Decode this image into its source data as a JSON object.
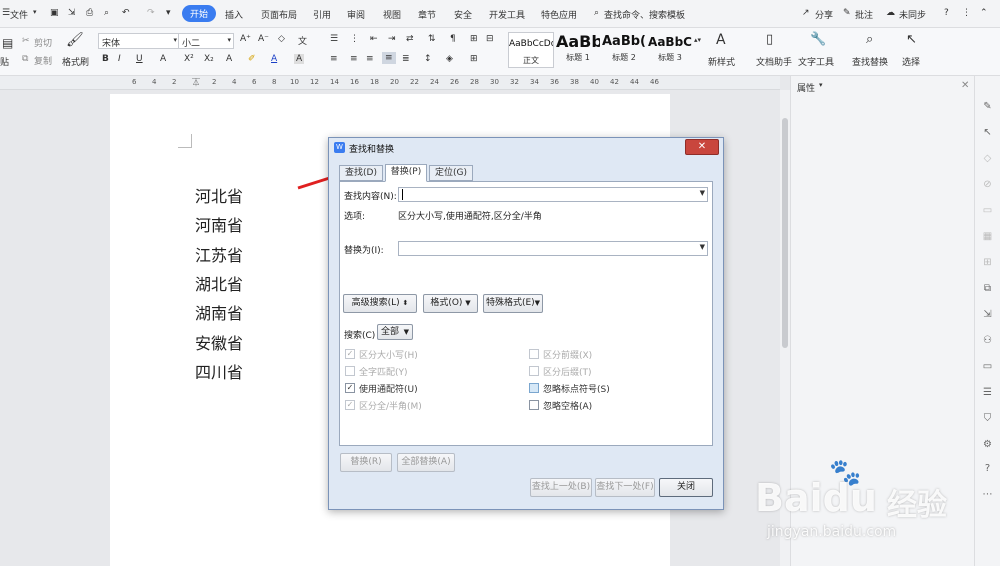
{
  "menubar": {
    "file": "文件",
    "tabs": [
      "开始",
      "插入",
      "页面布局",
      "引用",
      "审阅",
      "视图",
      "章节",
      "安全",
      "开发工具",
      "特色应用"
    ],
    "search": "查找命令、搜索模板",
    "share": "分享",
    "annotate": "批注",
    "sync": "未同步",
    "help": "?"
  },
  "ribbon": {
    "cut": "剪切",
    "copy": "复制",
    "paste": "贴",
    "format_painter": "格式刷",
    "font_name": "宋体",
    "font_size": "小二",
    "styles": [
      {
        "preview": "AaBbCcDd",
        "caption": "正文"
      },
      {
        "preview": "AaBb",
        "caption": "标题 1"
      },
      {
        "preview": "AaBb(",
        "caption": "标题 2"
      },
      {
        "preview": "AaBbC",
        "caption": "标题 3"
      }
    ],
    "new_style": "新样式",
    "doc_assistant": "文档助手",
    "text_tools": "文字工具",
    "find_replace": "查找替换",
    "select": "选择"
  },
  "ruler": {
    "ticks": [
      "6",
      "4",
      "2",
      "2",
      "4",
      "6",
      "8",
      "10",
      "12",
      "14",
      "16",
      "18",
      "20",
      "22",
      "24",
      "26",
      "28",
      "30",
      "32",
      "34",
      "36",
      "38",
      "40",
      "42",
      "44",
      "46"
    ]
  },
  "properties_panel": {
    "title": "属性"
  },
  "document": {
    "lines": [
      "河北省",
      "河南省",
      "江苏省",
      "湖北省",
      "湖南省",
      "安徽省",
      "四川省"
    ]
  },
  "dialog": {
    "title": "查找和替换",
    "close": "✕",
    "tabs": [
      "查找(D)",
      "替换(P)",
      "定位(G)"
    ],
    "find_label": "查找内容(N):",
    "find_value": "",
    "options_label": "选项:",
    "options_value": "区分大小写,使用通配符,区分全/半角",
    "replace_label": "替换为(I):",
    "replace_value": "",
    "advanced_search": "高级搜索(L)",
    "format": "格式(O)",
    "special_format": "特殊格式(E)",
    "search_label": "搜索(C)",
    "search_scope": "全部",
    "checkboxes_left": [
      {
        "label": "区分大小写(H)",
        "checked": true,
        "enabled": false
      },
      {
        "label": "全字匹配(Y)",
        "checked": false,
        "enabled": false
      },
      {
        "label": "使用通配符(U)",
        "checked": true,
        "enabled": true
      },
      {
        "label": "区分全/半角(M)",
        "checked": true,
        "enabled": false
      }
    ],
    "checkboxes_right": [
      {
        "label": "区分前缀(X)",
        "checked": false,
        "enabled": false
      },
      {
        "label": "区分后缀(T)",
        "checked": false,
        "enabled": false
      },
      {
        "label": "忽略标点符号(S)",
        "checked": false,
        "enabled": true
      },
      {
        "label": "忽略空格(A)",
        "checked": false,
        "enabled": true
      }
    ],
    "replace_btn": "替换(R)",
    "replace_all_btn": "全部替换(A)",
    "find_prev_btn": "查找上一处(B)",
    "find_next_btn": "查找下一处(F)",
    "close_btn": "关闭"
  },
  "watermark": {
    "brand": "Baidu",
    "cn": "经验",
    "url": "jingyan.baidu.com"
  },
  "colors": {
    "accent": "#3a7cf0",
    "arrow": "#e02020",
    "close": "#c9463d"
  }
}
